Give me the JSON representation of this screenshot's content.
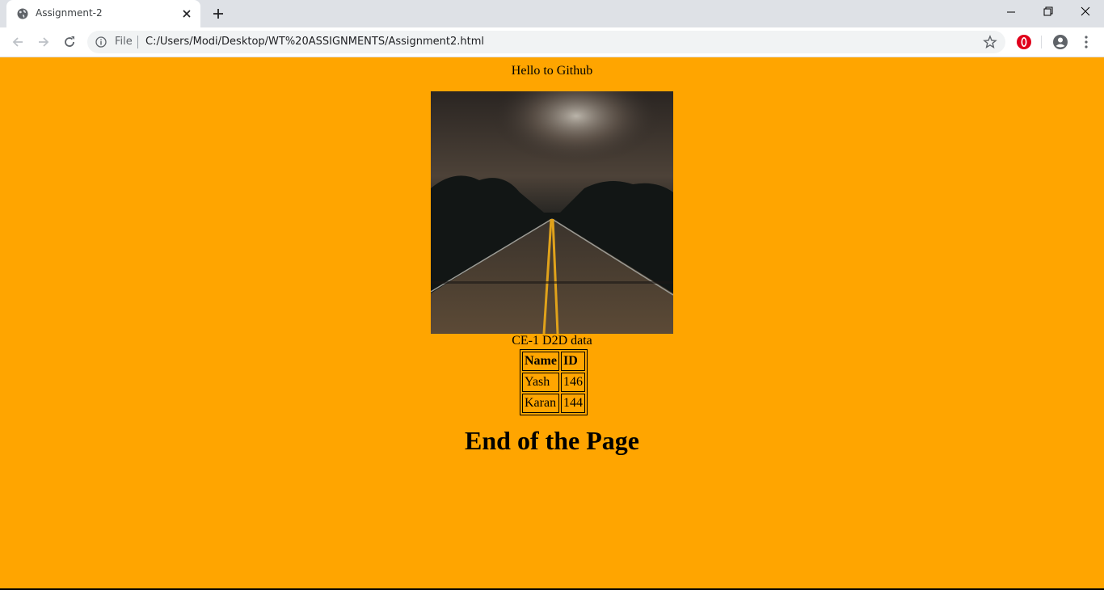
{
  "browser": {
    "tab_title": "Assignment-2",
    "address_scheme": "File",
    "address_url": "C:/Users/Modi/Desktop/WT%20ASSIGNMENTS/Assignment2.html"
  },
  "page": {
    "background_color": "#ffa500",
    "greeting": "Hello to Github",
    "image_alt": "road-photo",
    "caption": "CE-1 D2D data",
    "table": {
      "headers": [
        "Name",
        "ID"
      ],
      "rows": [
        [
          "Yash",
          "146"
        ],
        [
          "Karan",
          "144"
        ]
      ]
    },
    "footer_heading": "End of the Page"
  }
}
